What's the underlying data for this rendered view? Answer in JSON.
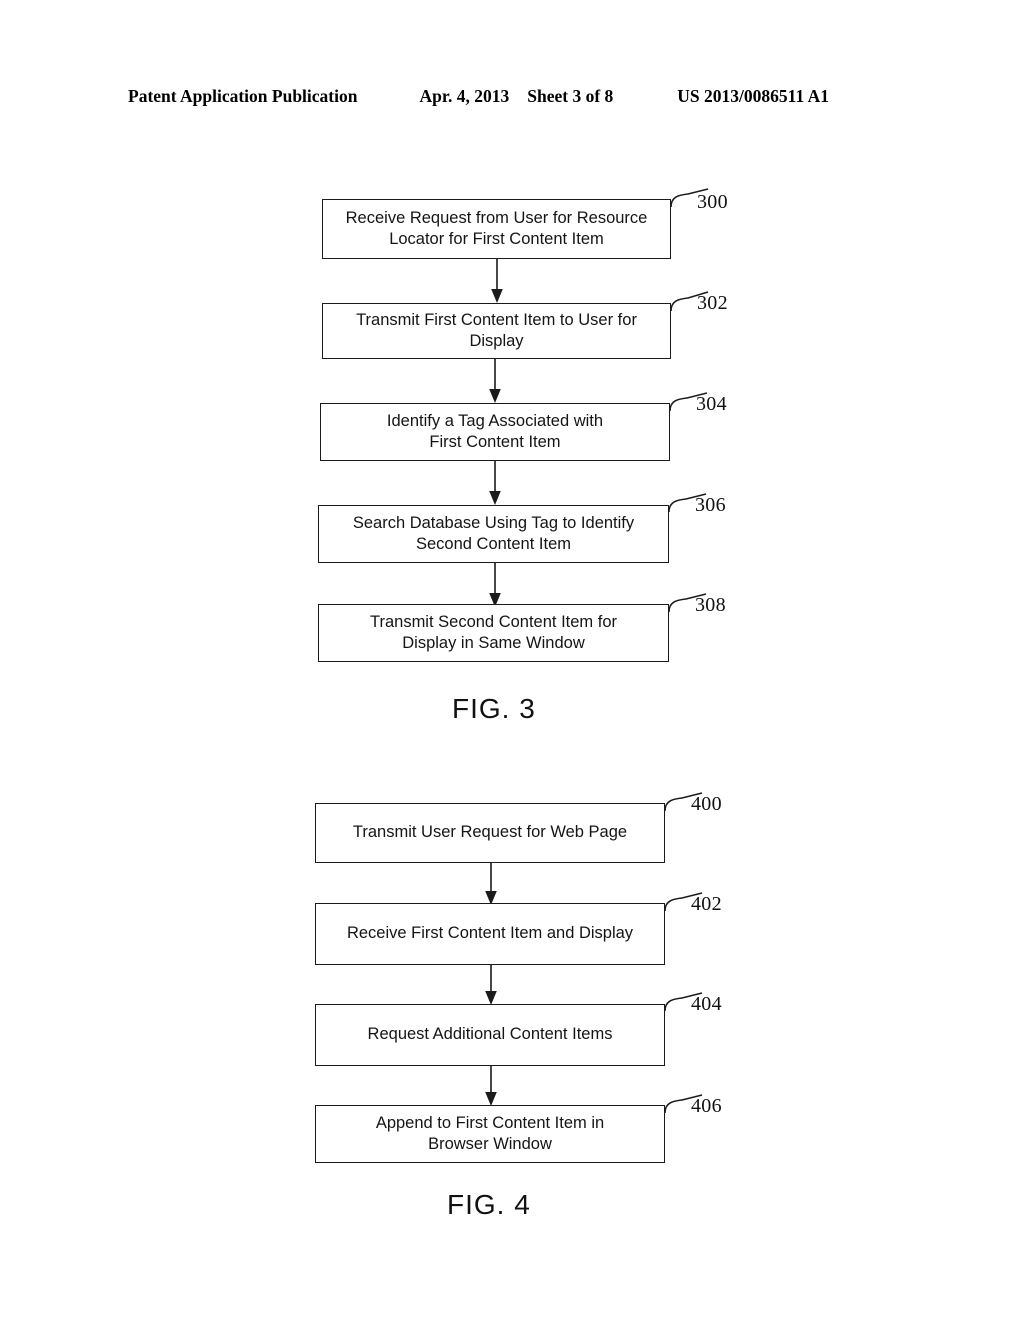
{
  "header": {
    "publication_label": "Patent Application Publication",
    "date": "Apr. 4, 2013",
    "sheet": "Sheet 3 of 8",
    "publication_number": "US 2013/0086511 A1"
  },
  "figures": [
    {
      "caption": "FIG. 3",
      "steps": [
        {
          "ref": "300",
          "text": "Receive Request from User for Resource\nLocator for First Content Item"
        },
        {
          "ref": "302",
          "text": "Transmit First Content Item to User for Display"
        },
        {
          "ref": "304",
          "text": "Identify a Tag Associated with\nFirst Content Item"
        },
        {
          "ref": "306",
          "text": "Search Database Using Tag to Identify\nSecond Content Item"
        },
        {
          "ref": "308",
          "text": "Transmit Second Content Item for\nDisplay in Same Window"
        }
      ]
    },
    {
      "caption": "FIG. 4",
      "steps": [
        {
          "ref": "400",
          "text": "Transmit User Request for Web Page"
        },
        {
          "ref": "402",
          "text": "Receive First Content Item and Display"
        },
        {
          "ref": "404",
          "text": "Request Additional Content Items"
        },
        {
          "ref": "406",
          "text": "Append to First Content Item in\nBrowser Window"
        }
      ]
    }
  ],
  "colors": {
    "ink": "#111111",
    "paper": "#ffffff"
  }
}
